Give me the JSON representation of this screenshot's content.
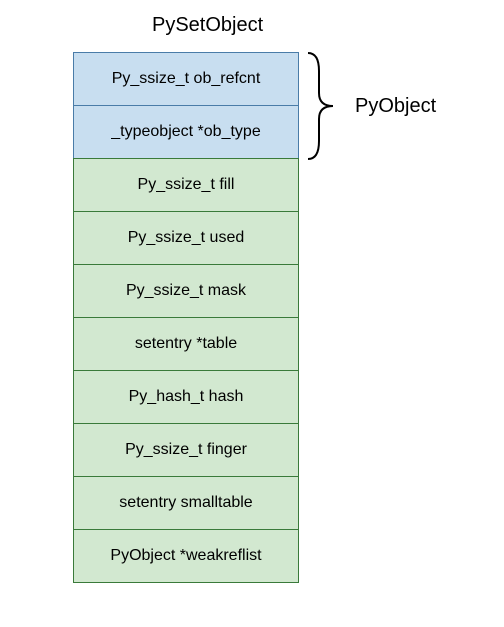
{
  "title": "PySetObject",
  "brace_label": "PyObject",
  "fields": {
    "f0": "Py_ssize_t ob_refcnt",
    "f1": "_typeobject *ob_type",
    "f2": "Py_ssize_t fill",
    "f3": "Py_ssize_t used",
    "f4": "Py_ssize_t mask",
    "f5": "setentry *table",
    "f6": "Py_hash_t hash",
    "f7": "Py_ssize_t finger",
    "f8": "setentry smalltable",
    "f9": "PyObject *weakreflist"
  },
  "colors": {
    "blue_fill": "#c8def0",
    "blue_border": "#4a7ca8",
    "green_fill": "#d2e8d0",
    "green_border": "#3a7a3a"
  }
}
